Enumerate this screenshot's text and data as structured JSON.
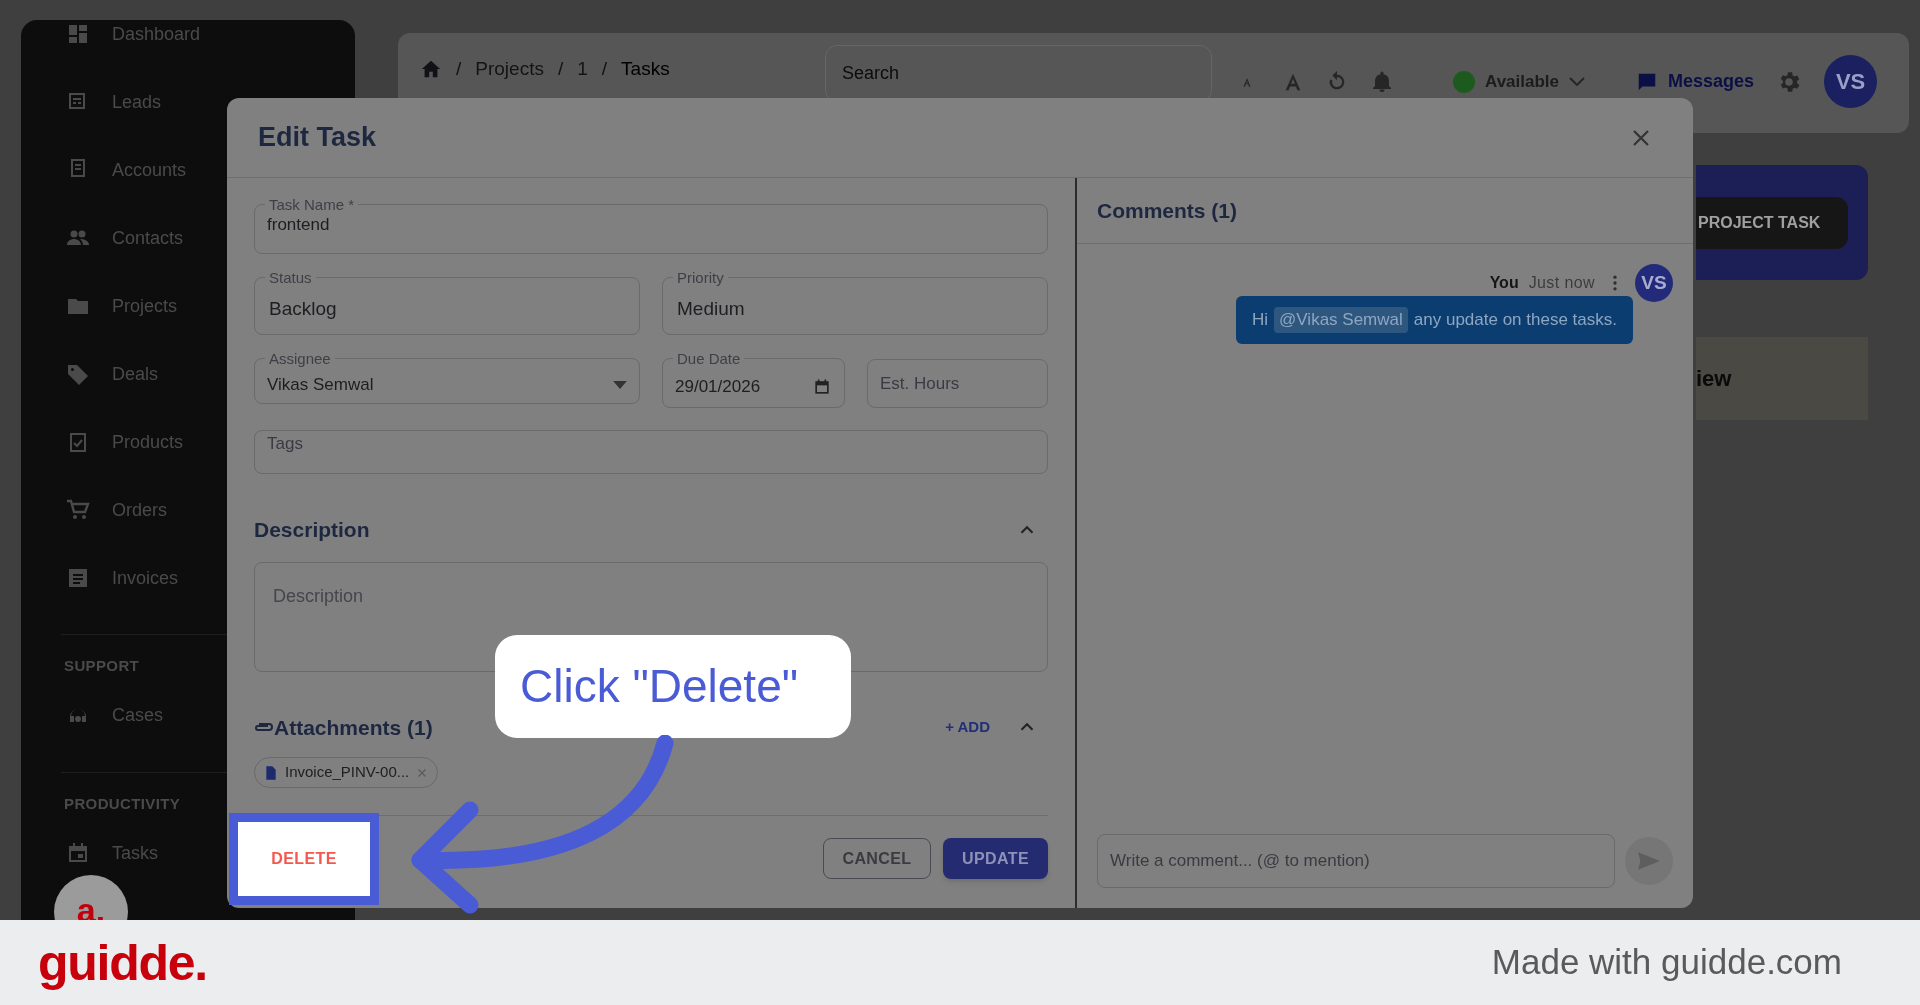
{
  "sidebar": {
    "items": [
      {
        "label": "Dashboard"
      },
      {
        "label": "Leads"
      },
      {
        "label": "Accounts"
      },
      {
        "label": "Contacts"
      },
      {
        "label": "Projects"
      },
      {
        "label": "Deals"
      },
      {
        "label": "Products"
      },
      {
        "label": "Orders"
      },
      {
        "label": "Invoices"
      }
    ],
    "sections": [
      {
        "heading": "SUPPORT",
        "items": [
          {
            "label": "Cases"
          }
        ]
      },
      {
        "heading": "PRODUCTIVITY",
        "items": [
          {
            "label": "Tasks"
          }
        ]
      }
    ]
  },
  "header": {
    "breadcrumb_separator": "/",
    "breadcrumb": [
      "Projects",
      "1",
      "Tasks"
    ],
    "search": {
      "placeholder": "Search"
    },
    "status": {
      "label": "Available"
    },
    "messages": "Messages",
    "user_initials": "VS"
  },
  "background": {
    "button": "PROJECT TASK",
    "card_text": "iew"
  },
  "modal": {
    "title": "Edit Task",
    "fields": [
      {
        "label": "Task Name *",
        "value": "frontend",
        "kind": "text"
      },
      {
        "label": "Status",
        "value": "Backlog",
        "kind": "text"
      },
      {
        "label": "Priority",
        "value": "Medium",
        "kind": "text"
      },
      {
        "label": "Assignee",
        "value": "Vikas Semwal",
        "kind": "select"
      },
      {
        "label": "Due Date",
        "value": "29/01/2026",
        "kind": "date"
      },
      {
        "placeholder": "Est. Hours",
        "kind": "text"
      },
      {
        "placeholder": "Tags",
        "kind": "text"
      }
    ],
    "description": {
      "heading": "Description",
      "expanded": true,
      "placeholder": "Description"
    },
    "attachments": {
      "heading": "Attachments (1)",
      "add": "+ ADD",
      "expanded": true,
      "files": [
        "Invoice_PINV-00..."
      ]
    },
    "actions": {
      "delete": "DELETE",
      "cancel": "CANCEL",
      "update": "UPDATE"
    },
    "comments": {
      "heading": "Comments (1)",
      "items": [
        {
          "author": "You",
          "time": "Just now",
          "initials": "VS",
          "before": "Hi",
          "mention": "@Vikas Semwal",
          "after": "any update on these tasks."
        }
      ],
      "input": {
        "placeholder": "Write a comment... (@ to mention)"
      }
    }
  },
  "callout": "Click \"Delete\"",
  "guide_avatar": "a.",
  "footer": {
    "logo": "guidde.",
    "credit": "Made with guidde.com"
  }
}
